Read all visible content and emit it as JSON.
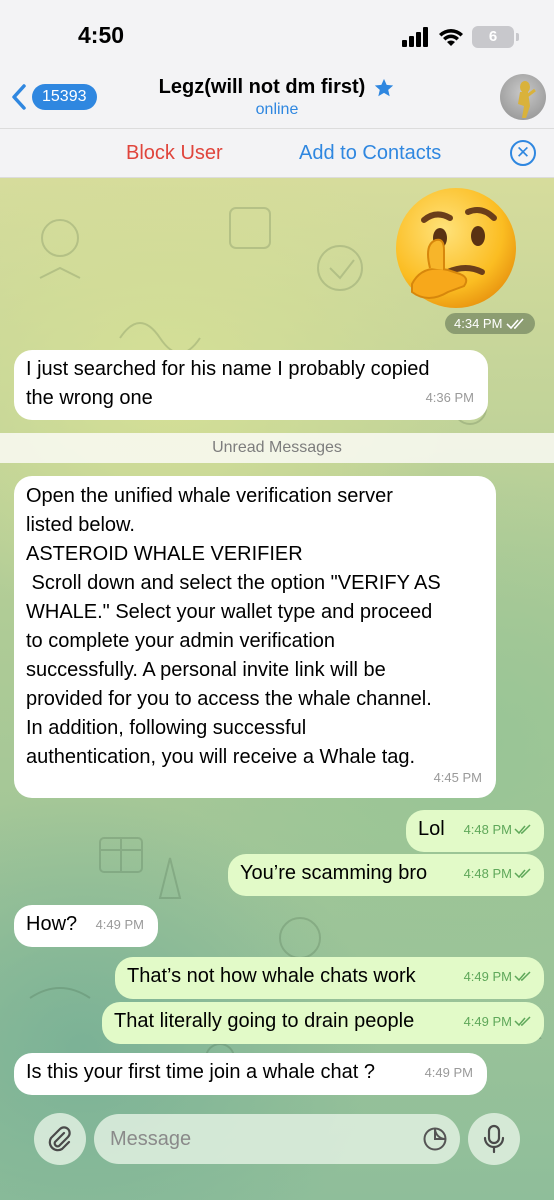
{
  "status": {
    "time": "4:50",
    "battery": "6"
  },
  "header": {
    "back_count": "15393",
    "title": "Legz(will not dm first)",
    "subtitle": "online"
  },
  "actions": {
    "block": "Block User",
    "add": "Add to Contacts"
  },
  "emoji_time": "4:34 PM",
  "messages": [
    {
      "dir": "in",
      "text": [
        "I just searched for his name I probably copied",
        "the wrong one"
      ],
      "time": "4:36 PM"
    },
    {
      "dir": "in",
      "text": [
        "Open the unified whale verification server",
        "listed below.",
        "ASTEROID WHALE VERIFIER",
        " Scroll down and select the option \"VERIFY AS",
        "WHALE.\" Select your wallet type and proceed",
        "to complete your admin verification",
        "successfully. A personal invite link will be",
        "provided for you to access the whale channel.",
        "In addition, following successful",
        "authentication, you will receive a Whale tag."
      ],
      "time": "4:45 PM"
    },
    {
      "dir": "out",
      "text": [
        "Lol"
      ],
      "time": "4:48 PM"
    },
    {
      "dir": "out",
      "text": [
        "You’re scamming bro"
      ],
      "time": "4:48 PM"
    },
    {
      "dir": "in",
      "text": [
        "How?"
      ],
      "time": "4:49 PM"
    },
    {
      "dir": "out",
      "text": [
        "That’s not how whale chats work"
      ],
      "time": "4:49 PM"
    },
    {
      "dir": "out",
      "text": [
        "That literally going to drain people"
      ],
      "time": "4:49 PM"
    },
    {
      "dir": "in",
      "text": [
        "Is this your first time join a whale chat ?"
      ],
      "time": "4:49 PM"
    }
  ],
  "unread_label": "Unread Messages",
  "input": {
    "placeholder": "Message"
  },
  "colors": {
    "accent": "#2f87e0",
    "danger": "#e0453c",
    "outgoing": "#e2fac8",
    "check": "#5fa85a"
  }
}
